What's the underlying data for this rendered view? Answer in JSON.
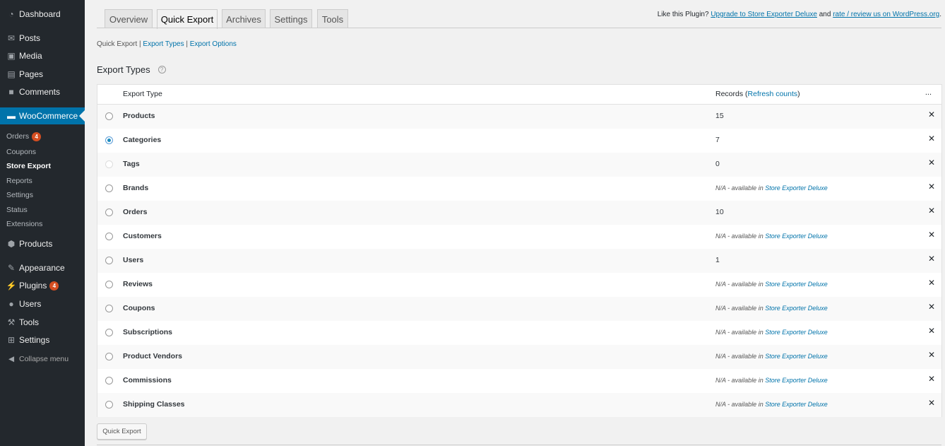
{
  "sidebar": {
    "items": [
      {
        "label": "Dashboard",
        "icon": "dashboard-icon"
      },
      {
        "label": "Posts",
        "icon": "pin-icon"
      },
      {
        "label": "Media",
        "icon": "media-icon"
      },
      {
        "label": "Pages",
        "icon": "pages-icon"
      },
      {
        "label": "Comments",
        "icon": "comment-icon"
      },
      {
        "label": "WooCommerce",
        "icon": "woocommerce-icon"
      },
      {
        "label": "Products",
        "icon": "cube-icon"
      },
      {
        "label": "Appearance",
        "icon": "brush-icon"
      },
      {
        "label": "Plugins",
        "icon": "plug-icon",
        "badge": "4"
      },
      {
        "label": "Users",
        "icon": "user-icon"
      },
      {
        "label": "Tools",
        "icon": "wrench-icon"
      },
      {
        "label": "Settings",
        "icon": "settings-icon"
      }
    ],
    "woo_sub": [
      {
        "label": "Orders",
        "badge": "4"
      },
      {
        "label": "Coupons"
      },
      {
        "label": "Store Export"
      },
      {
        "label": "Reports"
      },
      {
        "label": "Settings"
      },
      {
        "label": "Status"
      },
      {
        "label": "Extensions"
      }
    ],
    "collapse": "Collapse menu"
  },
  "tabs": [
    "Overview",
    "Quick Export",
    "Archives",
    "Settings",
    "Tools"
  ],
  "topright": {
    "prefix": "Like this Plugin?",
    "link1": "Upgrade to Store Exporter Deluxe",
    "and": "and",
    "link2": "rate / review us on WordPress.org",
    "suffix": "."
  },
  "subsub": {
    "current": "Quick Export",
    "link1": "Export Types",
    "link2": "Export Options"
  },
  "section_title": "Export Types",
  "table": {
    "col_type": "Export Type",
    "col_records": "Records",
    "refresh": "Refresh counts",
    "more": "...",
    "na_text": "N/A - available in",
    "na_link": "Store Exporter Deluxe",
    "rows": [
      {
        "name": "Products",
        "records": "15",
        "state": "unchecked"
      },
      {
        "name": "Categories",
        "records": "7",
        "state": "checked"
      },
      {
        "name": "Tags",
        "records": "0",
        "state": "disabled"
      },
      {
        "name": "Brands",
        "records": null,
        "state": "unchecked"
      },
      {
        "name": "Orders",
        "records": "10",
        "state": "unchecked"
      },
      {
        "name": "Customers",
        "records": null,
        "state": "unchecked"
      },
      {
        "name": "Users",
        "records": "1",
        "state": "unchecked"
      },
      {
        "name": "Reviews",
        "records": null,
        "state": "unchecked"
      },
      {
        "name": "Coupons",
        "records": null,
        "state": "unchecked"
      },
      {
        "name": "Subscriptions",
        "records": null,
        "state": "unchecked"
      },
      {
        "name": "Product Vendors",
        "records": null,
        "state": "unchecked"
      },
      {
        "name": "Commissions",
        "records": null,
        "state": "unchecked"
      },
      {
        "name": "Shipping Classes",
        "records": null,
        "state": "unchecked"
      }
    ]
  },
  "button": "Quick Export",
  "colors": {
    "accent": "#0073aa",
    "sidebar": "#23282d",
    "badge": "#d54e21"
  }
}
